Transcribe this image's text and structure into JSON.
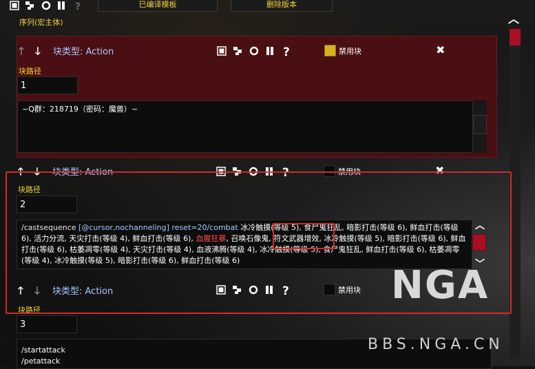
{
  "toolbar": {
    "compiled_template_label": "已编译模板",
    "delete_version_label": "删除版本"
  },
  "sequence_label": "序列(宏主体)",
  "blocks": [
    {
      "type_label": "块类型: Action",
      "disable_label": "禁用块",
      "disabled": true,
      "path_label": "块路径",
      "path_value": "1",
      "text": "~Q群：218719（密码：魔兽）~"
    },
    {
      "type_label": "块类型: Action",
      "disable_label": "禁用块",
      "disabled": false,
      "path_label": "块路径",
      "path_value": "2",
      "cast_cmd": "/castsequence",
      "cast_cond": "[@cursor,nochanneling]",
      "cast_reset": "reset=20/combat",
      "spells_a": " 冰冷触摸(等级 5), 食尸鬼狂乱, 暗影打击(等级 6), 鲜血打击(等级 6), 活力分流, 天灾打击(等级 4), 鲜血打击(等级 6), ",
      "spells_red": "血腥狂暴",
      "spells_b": ", 召唤石像鬼, 符文武器增效, 冰冷触摸(等级 5), 暗影打击(等级 6), 鲜血打击(等级 6), 枯萎凋零(等级 4), 天灾打击(等级 4), 血液沸腾(等级 4), 冰冷触摸(等级 5), 食尸鬼狂乱, 鲜血打击(等级 6), 枯萎凋零(等级 4), 冰冷触摸(等级 5), 暗影打击(等级 6), 鲜血打击(等级 6)"
    },
    {
      "type_label": "块类型: Action",
      "disable_label": "禁用块",
      "disabled": false,
      "path_label": "块路径",
      "path_value": "3",
      "line1": "/startattack",
      "line2": "/petattack"
    }
  ],
  "watermark": {
    "logo_text": "NGA",
    "site": "BBS.NGA.CN"
  },
  "colors": {
    "accent_yellow": "#f2d23c",
    "block_type_blue": "#a9c9ff",
    "disabled_block_bg": "#4a0f12",
    "highlight_red": "#d42a2a",
    "scroll_thumb_red": "#a80f24"
  }
}
